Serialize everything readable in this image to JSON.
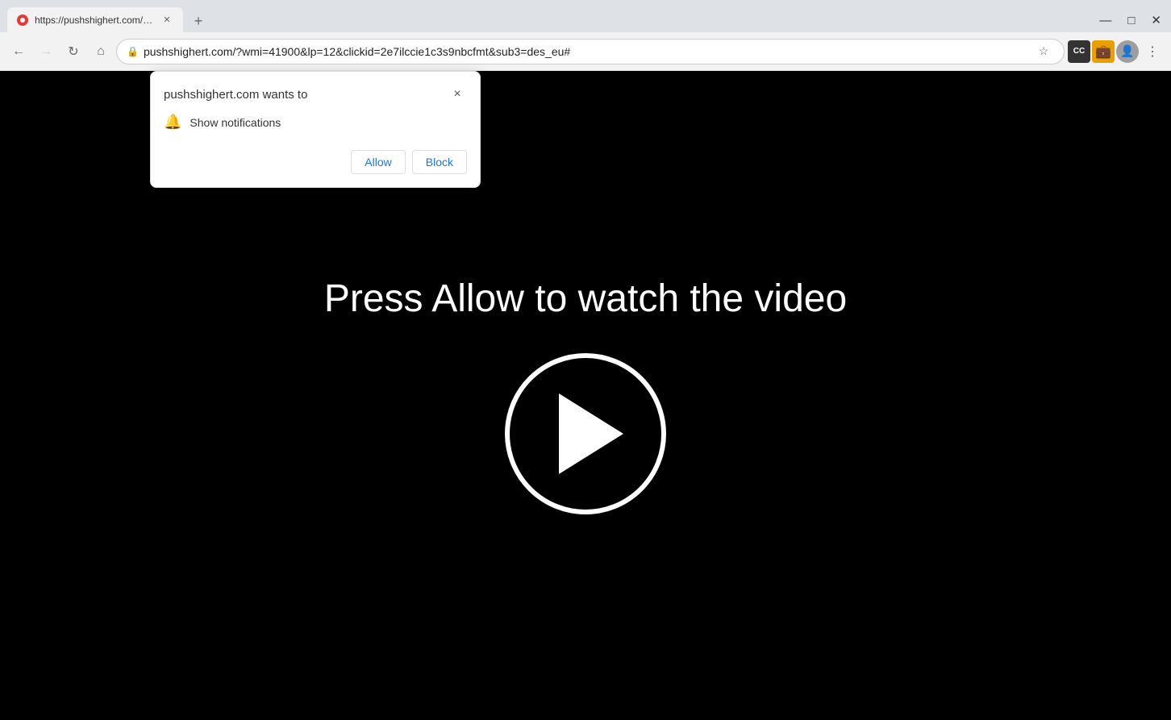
{
  "browser": {
    "tab": {
      "label": "https://pushshighert.com/?wmi=",
      "favicon": "red-circle"
    },
    "new_tab_label": "+",
    "window_controls": {
      "minimize": "—",
      "maximize": "□",
      "close": "✕"
    },
    "address_bar": {
      "url": "pushshighert.com/?wmi=41900&lp=12&clickid=2e7ilccie1c3s9nbcfmt&sub3=des_eu#",
      "lock_icon": "🔒"
    },
    "nav": {
      "back": "←",
      "forward": "→",
      "refresh": "↻",
      "home": "⌂"
    },
    "toolbar": {
      "star": "☆",
      "cc": "CC",
      "wallet": "🪙",
      "menu": "⋮",
      "profile": "👤"
    }
  },
  "notification_popup": {
    "title": "pushshighert.com wants to",
    "close_label": "×",
    "permission": {
      "icon": "🔔",
      "text": "Show notifications"
    },
    "buttons": {
      "allow": "Allow",
      "block": "Block"
    }
  },
  "page": {
    "title": "Press Allow to watch the video",
    "play_button_aria": "Play"
  }
}
